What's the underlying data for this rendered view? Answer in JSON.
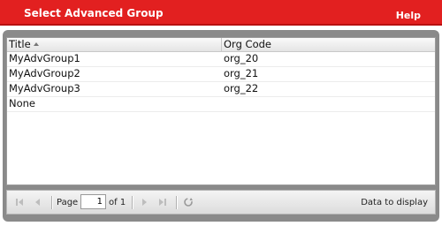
{
  "titlebar": {
    "title": "Select Advanced Group",
    "help": "Help"
  },
  "grid": {
    "columns": [
      "Title",
      "Org Code"
    ],
    "rows": [
      {
        "title": "MyAdvGroup1",
        "org_code": "org_20"
      },
      {
        "title": "MyAdvGroup2",
        "org_code": "org_21"
      },
      {
        "title": "MyAdvGroup3",
        "org_code": "org_22"
      },
      {
        "title": "None",
        "org_code": ""
      }
    ]
  },
  "pager": {
    "page_label": "Page",
    "current_page": "1",
    "of_label": "of 1",
    "status": "Data to display",
    "icons": [
      "first-page-icon",
      "prev-page-icon",
      "next-page-icon",
      "last-page-icon",
      "refresh-icon"
    ]
  },
  "colors": {
    "titlebar": "#e22020",
    "frame": "#8a8a8a"
  }
}
